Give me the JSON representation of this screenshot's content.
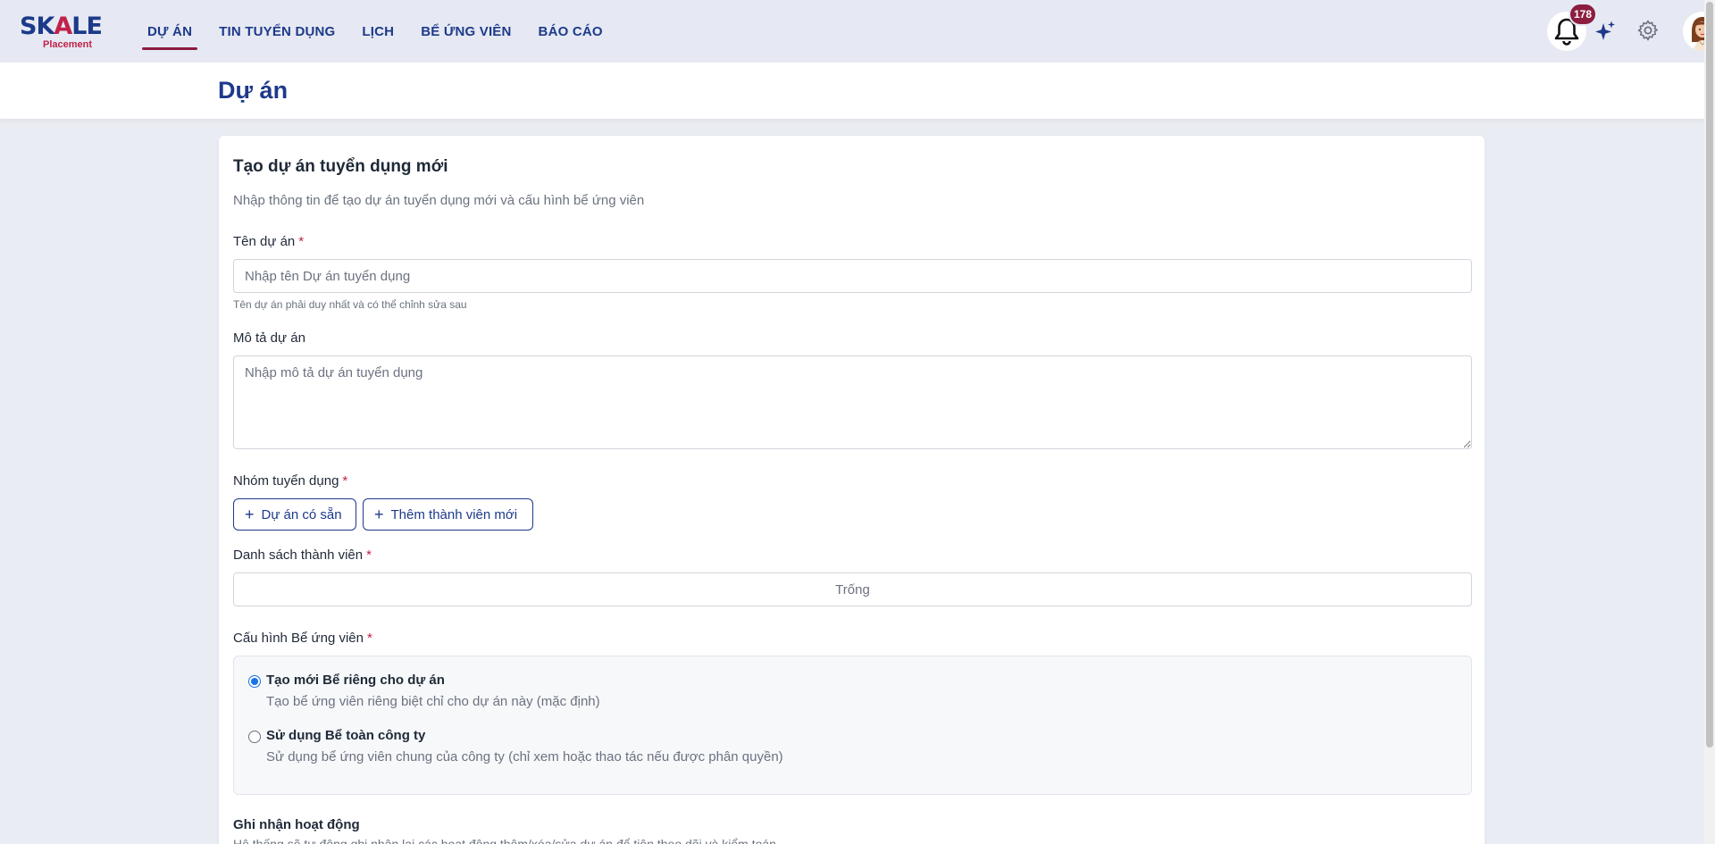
{
  "brand": {
    "logo_main_pre": "SK",
    "logo_main_a": "A",
    "logo_main_post": "LE",
    "logo_sub": "Placement",
    "accent_color": "#8b1d3f",
    "primary_color": "#1d3a8a"
  },
  "nav": {
    "items": [
      {
        "label": "DỰ ÁN",
        "active": true
      },
      {
        "label": "TIN TUYỂN DỤNG",
        "active": false
      },
      {
        "label": "LỊCH",
        "active": false
      },
      {
        "label": "BỂ ỨNG VIÊN",
        "active": false
      },
      {
        "label": "BÁO CÁO",
        "active": false
      }
    ]
  },
  "header_actions": {
    "notification_count": "178",
    "icons": [
      "bell-icon",
      "sparkle-icon",
      "gear-icon",
      "avatar"
    ]
  },
  "page": {
    "title": "Dự án"
  },
  "form": {
    "title": "Tạo dự án tuyển dụng mới",
    "description": "Nhập thông tin để tạo dự án tuyển dụng mới và cấu hình bể ứng viên",
    "project_name": {
      "label": "Tên dự án",
      "required_mark": "*",
      "placeholder": "Nhập tên Dự án tuyển dụng",
      "value": "",
      "help": "Tên dự án phải duy nhất và có thể chỉnh sửa sau"
    },
    "project_description": {
      "label": "Mô tả dự án",
      "placeholder": "Nhập mô tả dự án tuyển dụng",
      "value": ""
    },
    "recruitment_group": {
      "label": "Nhóm tuyển dụng",
      "required_mark": "*",
      "btn_existing": "Dự án có sẵn",
      "btn_add_member": "Thêm thành viên mới"
    },
    "member_list": {
      "label": "Danh sách thành viên",
      "required_mark": "*",
      "empty_text": "Trống"
    },
    "pool_config": {
      "label": "Cấu hình Bể ứng viên",
      "required_mark": "*",
      "options": [
        {
          "title": "Tạo mới Bể riêng cho dự án",
          "desc": "Tạo bể ứng viên riêng biệt chỉ cho dự án này (mặc định)",
          "checked": true
        },
        {
          "title": "Sử dụng Bể toàn công ty",
          "desc": "Sử dụng bể ứng viên chung của công ty (chỉ xem hoặc thao tác nếu được phân quyền)",
          "checked": false
        }
      ]
    },
    "activity_log": {
      "title": "Ghi nhận hoạt động",
      "desc": "Hệ thống sẽ tự động ghi nhận lại các hoạt động thêm/xóa/sửa dự án để tiện theo dõi và kiểm toán"
    }
  }
}
